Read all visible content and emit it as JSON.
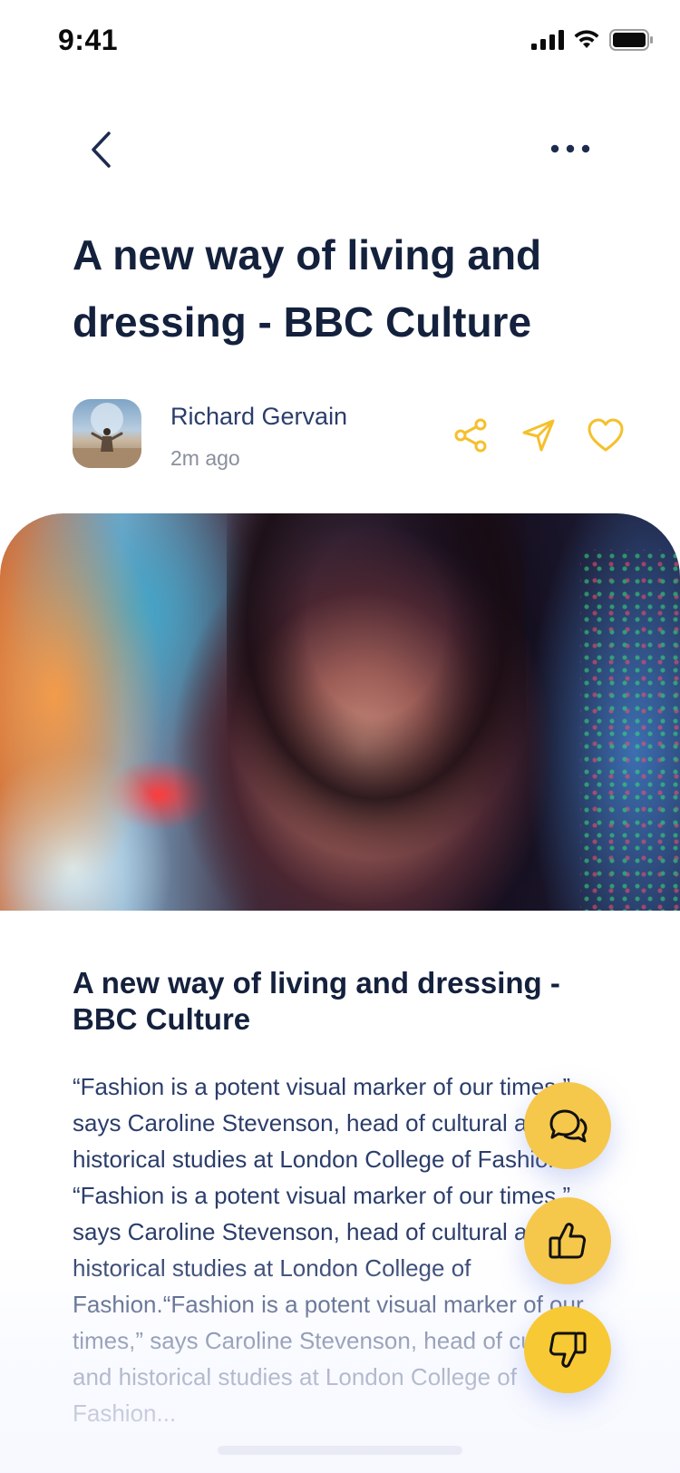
{
  "status_bar": {
    "time": "9:41"
  },
  "nav": {
    "back_icon": "chevron-left-icon",
    "more_icon": "more-horizontal-icon"
  },
  "article": {
    "title": "A new way of living and dressing - BBC Culture",
    "heading": "A new way of living and dressing - BBC Culture",
    "body": "“Fashion is a potent visual marker of our times,” says Caroline Stevenson, head of cultural and historical studies at London College of Fashion. “Fashion is a potent visual marker of our times,” says Caroline Stevenson, head of cultural and historical studies at London College of Fashion.“Fashion is a potent visual marker of our times,” says Caroline Stevenson, head of cultural and historical studies at London College of Fashion..."
  },
  "author": {
    "name": "Richard Gervain",
    "time": "2m ago"
  },
  "actions": {
    "share_icon": "share-icon",
    "send_icon": "send-icon",
    "favorite_icon": "heart-icon"
  },
  "fabs": {
    "comment_icon": "comment-icon",
    "like_icon": "thumbs-up-icon",
    "dislike_icon": "thumbs-down-icon"
  },
  "colors": {
    "accent": "#f5c84c",
    "text_primary": "#14213d",
    "text_secondary": "#2b3d6b",
    "muted": "#8a8f9c"
  }
}
